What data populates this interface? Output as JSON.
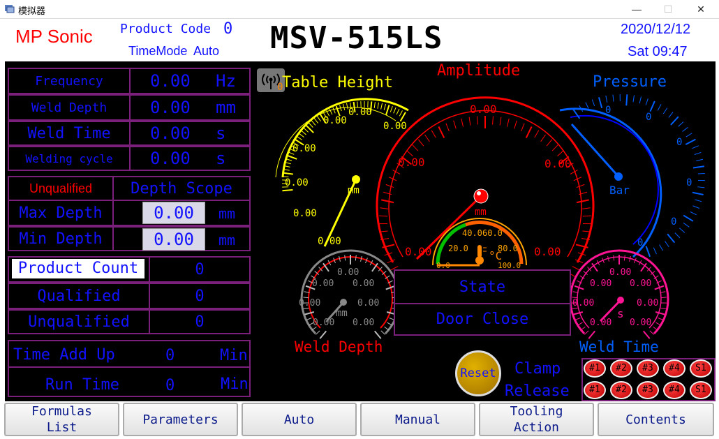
{
  "window": {
    "title": "模拟器",
    "minimize": "—",
    "maximize": "☐",
    "close": "✕"
  },
  "header": {
    "brand": "MP Sonic",
    "product_code_label": "Product Code",
    "product_code_value": "0",
    "time_mode": "TimeMode",
    "mode_value": "Auto",
    "model": "MSV-515LS",
    "date": "2020/12/12",
    "weekday_time": "Sat 09:47"
  },
  "params": [
    {
      "label": "Frequency",
      "value": "0.00",
      "unit": "Hz"
    },
    {
      "label": "Weld Depth",
      "value": "0.00",
      "unit": "mm"
    },
    {
      "label": "Weld Time",
      "value": "0.00",
      "unit": "s"
    },
    {
      "label": "Welding cycle",
      "value": "0.00",
      "unit": "s"
    }
  ],
  "depth": {
    "unqualified_label": "Unqualified",
    "scope_label": "Depth Scope",
    "max_label": "Max Depth",
    "max_value": "0.00",
    "max_unit": "mm",
    "min_label": "Min Depth",
    "min_value": "0.00",
    "min_unit": "mm"
  },
  "counts": {
    "product_count_label": "Product Count",
    "product_count": "0",
    "qualified_label": "Qualified",
    "qualified": "0",
    "unqualified_label": "Unqualified",
    "unqualified": "0"
  },
  "time": {
    "add_up_label": "Time Add Up",
    "add_up": "0",
    "add_up_unit": "Min",
    "run_label": "Run Time",
    "run": "0",
    "run_unit": "Min"
  },
  "gauges": {
    "table_height": {
      "title": "Table Height",
      "unit": "mm",
      "ticks": [
        "0.00",
        "0.00",
        "0.00",
        "0.00",
        "0.00",
        "0.00",
        "0.00",
        "0.00"
      ],
      "color": "#ffff00",
      "value": 0
    },
    "amplitude": {
      "title": "Amplitude",
      "unit": "mm",
      "ticks": [
        "0.00",
        "0.00",
        "0.00",
        "0.00",
        "0.00"
      ],
      "color": "#ff0000",
      "value": 0
    },
    "pressure": {
      "title": "Pressure",
      "unit": "Bar",
      "ticks": [
        "0",
        "0",
        "0",
        "0",
        "0",
        "0"
      ],
      "color": "#0050ff",
      "value": 0
    },
    "temperature": {
      "unit": "°C",
      "ticks": [
        "0.0",
        "20.0",
        "40.0",
        "60.0",
        "80.0",
        "100.0"
      ],
      "value": 0
    },
    "weld_depth": {
      "title": "Weld Depth",
      "unit": "mm",
      "ticks": [
        "0.00",
        "0.00",
        "0.00",
        "0.00",
        "0.00",
        "0.00",
        "0.00"
      ],
      "color": "#888888",
      "value": 0
    },
    "weld_time": {
      "title": "Weld Time",
      "unit": "s",
      "ticks": [
        "0.00",
        "0.00",
        "0.00",
        "0.00",
        "0.00",
        "0.00",
        "0.00"
      ],
      "color": "#ff1493",
      "value": 0
    }
  },
  "status": {
    "state": "State",
    "door": "Door Close"
  },
  "controls": {
    "reset": "Reset",
    "clamp": "Clamp",
    "release": "Release",
    "clamp_buttons": [
      "#1",
      "#2",
      "#3",
      "#4",
      "S1"
    ],
    "release_buttons": [
      "#1",
      "#2",
      "#3",
      "#4",
      "S1"
    ]
  },
  "nav": [
    "Formulas\nList",
    "Parameters",
    "Auto",
    "Manual",
    "Tooling\nAction",
    "Contents"
  ],
  "colors": {
    "panel_bg": "#000000",
    "border": "#7a1f7a",
    "text_blue": "#1212ff",
    "alarm_red": "#ff0000"
  }
}
